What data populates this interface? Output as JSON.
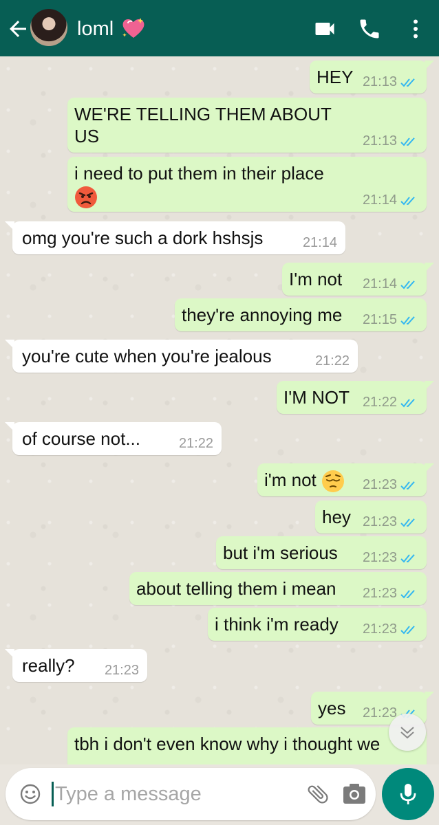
{
  "header": {
    "contact_name": "loml",
    "heart_emoji": "sparkling-heart",
    "icons": [
      "back-arrow-icon",
      "video-call-icon",
      "phone-icon",
      "more-vert-icon"
    ]
  },
  "messages": [
    {
      "dir": "out",
      "text": "HEY",
      "time": "21:13",
      "status": "read"
    },
    {
      "dir": "out",
      "text": "WE'RE TELLING THEM ABOUT US",
      "line1": "WE'RE TELLING THEM ABOUT",
      "line2": "US",
      "time": "21:13",
      "status": "read"
    },
    {
      "dir": "out",
      "text": "i need to put them in their place",
      "emoji": "angry-face",
      "time": "21:14",
      "status": "read"
    },
    {
      "dir": "in",
      "text": "omg you're such a dork hshsjs",
      "time": "21:14"
    },
    {
      "dir": "out",
      "text": "I'm not",
      "time": "21:14",
      "status": "read"
    },
    {
      "dir": "out",
      "text": "they're annoying me",
      "time": "21:15",
      "status": "read"
    },
    {
      "dir": "in",
      "text": "you're cute when you're jealous",
      "time": "21:22"
    },
    {
      "dir": "out",
      "text": "I'M NOT",
      "time": "21:22",
      "status": "read"
    },
    {
      "dir": "in",
      "text": "of course not...",
      "time": "21:22"
    },
    {
      "dir": "out",
      "text": "i'm not",
      "emoji": "pensive-face",
      "time": "21:23",
      "status": "read"
    },
    {
      "dir": "out",
      "text": "hey",
      "time": "21:23",
      "status": "read"
    },
    {
      "dir": "out",
      "text": "but i'm serious",
      "time": "21:23",
      "status": "read"
    },
    {
      "dir": "out",
      "text": "about telling them i mean",
      "time": "21:23",
      "status": "read"
    },
    {
      "dir": "out",
      "text": "i think i'm ready",
      "time": "21:23",
      "status": "read"
    },
    {
      "dir": "in",
      "text": "really?",
      "time": "21:23"
    },
    {
      "dir": "out",
      "text": "yes",
      "time": "21:23",
      "status": "read"
    },
    {
      "dir": "out",
      "text": "tbh i don't even know why i thought we",
      "time": "",
      "status": "partially-visible"
    }
  ],
  "composer": {
    "placeholder": "Type a message",
    "value": ""
  },
  "colors": {
    "header": "#075e54",
    "outgoing_bubble": "#dcf8c6",
    "incoming_bubble": "#ffffff",
    "read_ticks": "#34b7f1",
    "mic_button": "#00897b"
  }
}
